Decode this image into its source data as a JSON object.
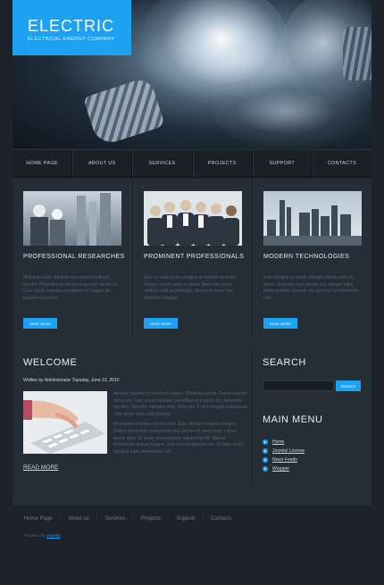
{
  "header": {
    "logo_title": "ELECTRIC",
    "logo_subtitle": "ELECTRICAL ENERGY COMPANY"
  },
  "nav": {
    "items": [
      "HOME PAGE",
      "ABOUT US",
      "SERVICES",
      "PROJECTS",
      "SUPPORT",
      "CONTACTS"
    ]
  },
  "features": [
    {
      "title": "PROFESSIONAL RESEARCHES",
      "text": "Molestie lacus. Aenean nonummy hendrerit mauris. Phasellus porta fusce suscipit varius mi. Cum sociis natoque penatibus et magnis dis parturient montes.",
      "button": "READ MORE",
      "icon": "industrial-workers-image"
    },
    {
      "title": "PROMINENT PROFESSIONALS",
      "text": "Mae ne nulla porta volutpat id suscipit at turpis. Integer rutrum ante eu libero liberu nisl porta vedisce sotit scelerisque. Mauris et lacus inte pharetra voluptat.",
      "button": "READ MORE",
      "icon": "business-team-image"
    },
    {
      "title": "MODERN TECHNOLOGIES",
      "text": "Erat volutpat ac turpis. Integer rutrum ante eu libero. Vivamus eget ornare nisl. Integer nulla porta vedisce ulcorper dui ignorae condimentum velit.",
      "button": "READ MORE",
      "icon": "city-skyline-image"
    }
  ],
  "welcome": {
    "title": "WELCOME",
    "meta": "Written by Administrator Tuesday, June 15, 2010",
    "paragraph1": "Aenean nonummy hendrerit mauris. Phasellus porta. Fusce suscipit varius mi. Cum sociis natoque penatibus et magnis dis parturient montes, nascetur ridiculus mus. Nulla dui. Fusce feugiat malesuada odio morbi nunc odio gravida.",
    "paragraph2": "Maecenas tristique est sit amet. Duis ultricies pharetra magna. Donec accumsan malesuada orci. Donec sit amet eros. Lorem ipsum dolor sit amet, consectetuer adipiscing elit. Mauris fermentum dictum magna. Sed laoreet aliquam leo. Ut tellus dolor, dapibus eget, elementum vel.",
    "read_more": "READ MORE",
    "icon": "hand-keyboard-image"
  },
  "sidebar": {
    "search_title": "SEARCH",
    "search_placeholder": "",
    "search_button": "SEARCH",
    "menu_title": "MAIN MENU",
    "menu_items": [
      "Home",
      "Joomla! License",
      "News Feeds",
      "Wrapper"
    ]
  },
  "footer": {
    "links": [
      "Home Page",
      "About us",
      "Services",
      "Projects",
      "Support",
      "Contacts"
    ],
    "powered_prefix": "Powered by",
    "powered_link": "Joomla!"
  },
  "colors": {
    "accent": "#1da1f2",
    "background": "#1c232a",
    "panel": "#252e37"
  }
}
